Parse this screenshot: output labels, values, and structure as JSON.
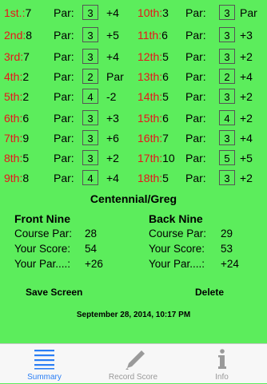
{
  "holes": [
    {
      "num": "1st.:",
      "strokes": "7",
      "par_label": "Par:",
      "par": "3",
      "rel": "+4"
    },
    {
      "num": "2nd:",
      "strokes": "8",
      "par_label": "Par:",
      "par": "3",
      "rel": "+5"
    },
    {
      "num": "3rd:",
      "strokes": "7",
      "par_label": "Par:",
      "par": "3",
      "rel": "+4"
    },
    {
      "num": "4th:",
      "strokes": "2",
      "par_label": "Par:",
      "par": "2",
      "rel": "Par"
    },
    {
      "num": "5th:",
      "strokes": "2",
      "par_label": "Par:",
      "par": "4",
      "rel": "-2"
    },
    {
      "num": "6th:",
      "strokes": "6",
      "par_label": "Par:",
      "par": "3",
      "rel": "+3"
    },
    {
      "num": "7th:",
      "strokes": "9",
      "par_label": "Par:",
      "par": "3",
      "rel": "+6"
    },
    {
      "num": "8th:",
      "strokes": "5",
      "par_label": "Par:",
      "par": "3",
      "rel": "+2"
    },
    {
      "num": "9th:",
      "strokes": "8",
      "par_label": "Par:",
      "par": "4",
      "rel": "+4"
    },
    {
      "num": "10th:",
      "strokes": "3",
      "par_label": "Par:",
      "par": "3",
      "rel": "Par"
    },
    {
      "num": "11th:",
      "strokes": "6",
      "par_label": "Par:",
      "par": "3",
      "rel": "+3"
    },
    {
      "num": "12th:",
      "strokes": "5",
      "par_label": "Par:",
      "par": "3",
      "rel": "+2"
    },
    {
      "num": "13th:",
      "strokes": "6",
      "par_label": "Par:",
      "par": "2",
      "rel": "+4"
    },
    {
      "num": "14th:",
      "strokes": "5",
      "par_label": "Par:",
      "par": "3",
      "rel": "+2"
    },
    {
      "num": "15th:",
      "strokes": "6",
      "par_label": "Par:",
      "par": "4",
      "rel": "+2"
    },
    {
      "num": "16th:",
      "strokes": "7",
      "par_label": "Par:",
      "par": "3",
      "rel": "+4"
    },
    {
      "num": "17th:",
      "strokes": "10",
      "par_label": "Par:",
      "par": "5",
      "rel": "+5"
    },
    {
      "num": "18th:",
      "strokes": "5",
      "par_label": "Par:",
      "par": "3",
      "rel": "+2"
    }
  ],
  "course_title": "Centennial/Greg",
  "front_nine": {
    "heading": "Front Nine",
    "course_par_label": "Course Par:",
    "course_par": "28",
    "score_label": "Your Score:",
    "score": "54",
    "par_label": "Your Par....:",
    "par_rel": "+26"
  },
  "back_nine": {
    "heading": "Back Nine",
    "course_par_label": "Course Par:",
    "course_par": "29",
    "score_label": "Your Score:",
    "score": "53",
    "par_label": "Your Par....:",
    "par_rel": "+24"
  },
  "actions": {
    "save": "Save Screen",
    "delete": "Delete"
  },
  "timestamp": "September 28, 2014, 10:17 PM",
  "tabs": [
    {
      "label": "Summary",
      "icon": "list-icon",
      "active": true
    },
    {
      "label": "Record Score",
      "icon": "pencil-icon",
      "active": false
    },
    {
      "label": "Info",
      "icon": "info-icon",
      "active": false
    }
  ],
  "colors": {
    "background": "#5ced5c",
    "hole_number": "#e8141a",
    "tab_active": "#2a7ef5",
    "tab_inactive": "#999999"
  }
}
